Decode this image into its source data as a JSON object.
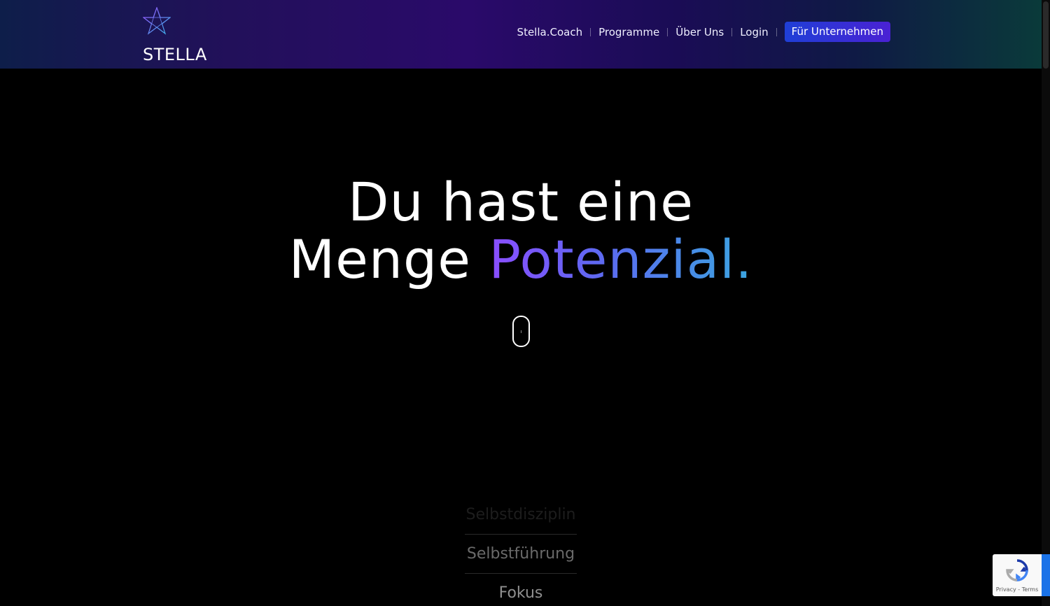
{
  "brand": {
    "name": "STELLA"
  },
  "nav": {
    "items": [
      "Stella.Coach",
      "Programme",
      "Über Uns",
      "Login"
    ],
    "cta": "Für Unternehmen"
  },
  "hero": {
    "line1": "Du hast eine",
    "line2_prefix": "Menge ",
    "line2_accent": "Potenzial."
  },
  "rotating_words": [
    "Selbstdisziplin",
    "Selbstführung",
    "Fokus"
  ],
  "recaptcha": {
    "links": "Privacy - Terms"
  },
  "icons": {
    "logo": "star-logo-icon",
    "scroll": "mouse-scroll-icon",
    "recaptcha": "recaptcha-logo-icon"
  },
  "colors": {
    "header_gradient_start": "#0e1e4a",
    "header_gradient_mid": "#2a0a6a",
    "header_gradient_end": "#0a3a3a",
    "cta": "#2d34d6",
    "accent_start": "#8a4dff",
    "accent_end": "#3aa6e0",
    "background": "#000000"
  }
}
